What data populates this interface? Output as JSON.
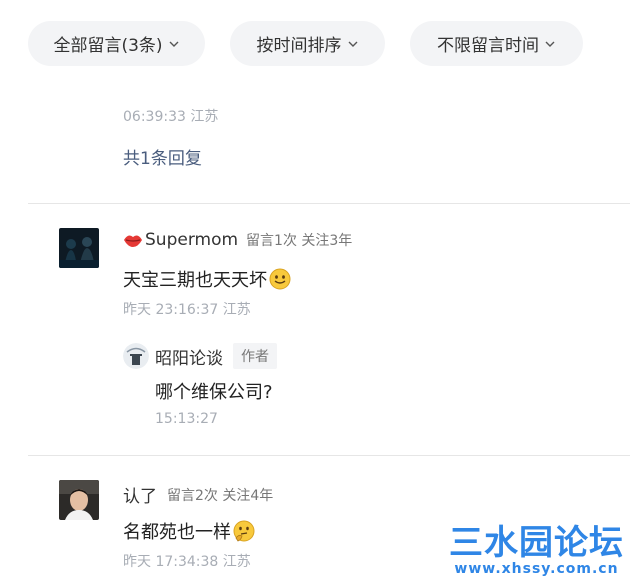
{
  "filters": {
    "all_comments": "全部留言(3条)",
    "sort": "按时间排序",
    "time_range": "不限留言时间"
  },
  "prev_comment": {
    "time_loc": "06:39:33 江苏",
    "reply_count": "共1条回复"
  },
  "comments": [
    {
      "nick": "Supermom",
      "stats": "留言1次 关注3年",
      "text": "天宝三期也天天坏",
      "emoji": "smile-emoji",
      "time_loc": "昨天 23:16:37 江苏",
      "reply": {
        "nick": "昭阳论谈",
        "tag": "作者",
        "text": "哪个维保公司?",
        "time": "15:13:27"
      }
    },
    {
      "nick": "认了",
      "stats": "留言2次 关注4年",
      "text": "名都苑也一样",
      "emoji": "thinking-emoji",
      "time_loc": "昨天 17:34:38 江苏"
    }
  ],
  "watermark": {
    "main": "三水园论坛",
    "sub": "www.xhssy.com.cn"
  },
  "colors": {
    "link": "#4a5d7e",
    "pill_bg": "#f3f4f6",
    "watermark": "#2f86e6"
  }
}
